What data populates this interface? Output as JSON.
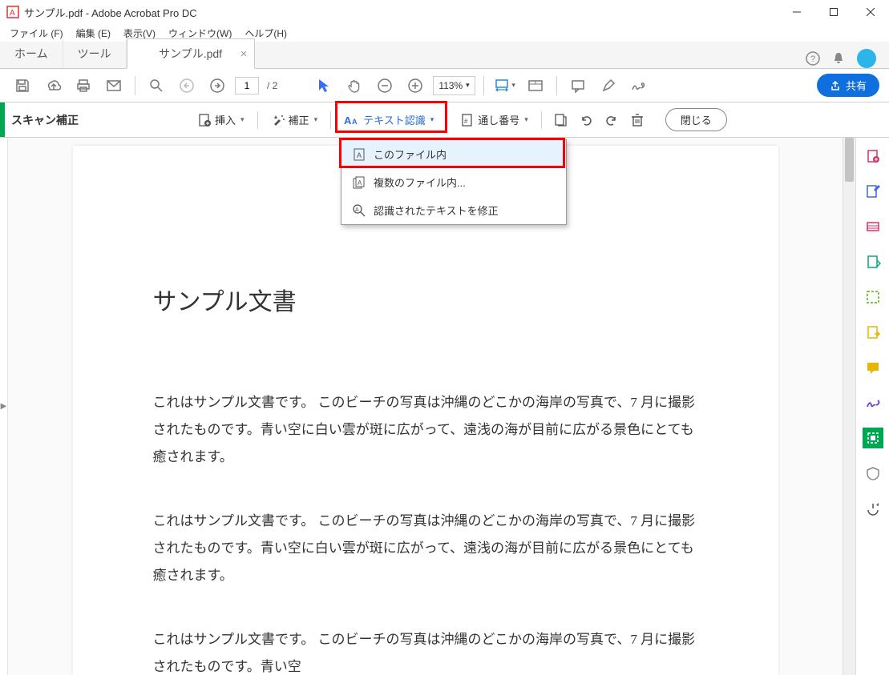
{
  "window": {
    "title": "サンプル.pdf - Adobe Acrobat Pro DC"
  },
  "menu": {
    "file": "ファイル (F)",
    "edit": "編集 (E)",
    "view": "表示(V)",
    "window": "ウィンドウ(W)",
    "help": "ヘルプ(H)"
  },
  "tabs": {
    "home": "ホーム",
    "tools": "ツール",
    "active": "サンプル.pdf"
  },
  "toolbar1": {
    "page_current": "1",
    "page_total": "/ 2",
    "zoom": "113%",
    "share": "共有"
  },
  "toolbar2": {
    "section": "スキャン補正",
    "insert": "挿入",
    "correct": "補正",
    "ocr": "テキスト認識",
    "bates": "通し番号",
    "close": "閉じる"
  },
  "dropdown": {
    "in_this_file": "このファイル内",
    "in_multiple": "複数のファイル内...",
    "correct_text": "認識されたテキストを修正"
  },
  "document": {
    "heading": "サンプル文書",
    "p1": "これはサンプル文書です。\nこのビーチの写真は沖縄のどこかの海岸の写真で、7 月に撮影されたものです。青い空に白い雲が斑に広がって、遠浅の海が目前に広がる景色にとても癒されます。",
    "p2": "これはサンプル文書です。\nこのビーチの写真は沖縄のどこかの海岸の写真で、7 月に撮影されたものです。青い空に白い雲が斑に広がって、遠浅の海が目前に広がる景色にとても癒されます。",
    "p3": "これはサンプル文書です。\nこのビーチの写真は沖縄のどこかの海岸の写真で、7 月に撮影されたものです。青い空"
  },
  "right_panel_icons": [
    "create-pdf",
    "edit-pdf",
    "export-pdf",
    "organize",
    "enhance",
    "comment",
    "fill-sign",
    "scan-active",
    "protect",
    "more-tools"
  ]
}
